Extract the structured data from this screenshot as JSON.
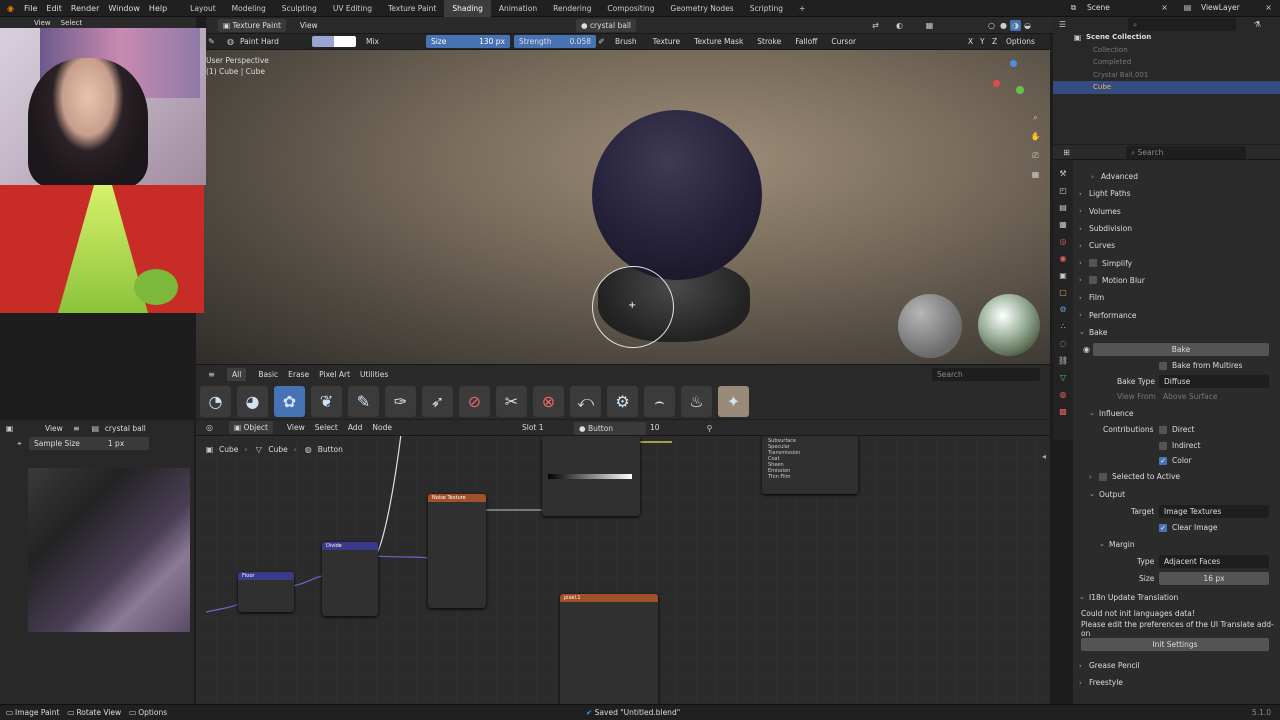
{
  "menu": [
    "File",
    "Edit",
    "Render",
    "Window",
    "Help"
  ],
  "workspaces": [
    "Layout",
    "Modeling",
    "Sculpting",
    "UV Editing",
    "Texture Paint",
    "Shading",
    "Animation",
    "Rendering",
    "Compositing",
    "Geometry Nodes",
    "Scripting"
  ],
  "active_workspace": "Shading",
  "scene": "Scene",
  "view_layer": "ViewLayer",
  "sub_left": {
    "view": "View",
    "select": "Select"
  },
  "viewport_header": {
    "mode": "Texture Paint",
    "view": "View",
    "object_name": "crystal ball",
    "brush": "Paint Hard",
    "blend": "Mix",
    "size_label": "Size",
    "size_value": "130 px",
    "strength_label": "Strength",
    "strength_value": "0.058",
    "menus": [
      "Brush",
      "Texture",
      "Texture Mask",
      "Stroke",
      "Falloff",
      "Cursor"
    ],
    "axes": [
      "X",
      "Y",
      "Z"
    ],
    "options": "Options"
  },
  "viewport": {
    "perspective": "User Perspective",
    "object": "(1) Cube | Cube"
  },
  "brush_tabs": [
    "All",
    "Basic",
    "Erase",
    "Pixel Art",
    "Utilities"
  ],
  "brush_search_placeholder": "Search",
  "outliner": {
    "title": "Scene Collection",
    "items": [
      "Collection",
      "Completed",
      "Crystal Ball.001",
      "Cube"
    ]
  },
  "props_search_placeholder": "Search",
  "properties": {
    "sections": [
      "Advanced",
      "Light Paths",
      "Volumes",
      "Subdivision",
      "Curves",
      "Simplify",
      "Motion Blur",
      "Film",
      "Performance",
      "Bake"
    ],
    "bake_button": "Bake",
    "bake_from_multires": "Bake from Multires",
    "bake_type_label": "Bake Type",
    "bake_type_value": "Diffuse",
    "view_from_label": "View From",
    "view_from_value": "Above Surface",
    "influence": "Influence",
    "contributions": "Contributions",
    "direct": "Direct",
    "indirect": "Indirect",
    "color": "Color",
    "selected_to_active": "Selected to Active",
    "output": "Output",
    "target_label": "Target",
    "target_value": "Image Textures",
    "clear_image": "Clear Image",
    "margin": "Margin",
    "type_label": "Type",
    "type_value": "Adjacent Faces",
    "size_label": "Size",
    "size_value": "16 px",
    "i18n_title": "I18n Update Translation",
    "i18n_msg1": "Could not init languages data!",
    "i18n_msg2": "Please edit the preferences of the UI Translate add-on",
    "init_settings": "Init Settings",
    "grease_pencil": "Grease Pencil",
    "freestyle": "Freestyle"
  },
  "image_editor": {
    "view": "View",
    "image_name": "crystal ball",
    "sample_size_label": "Sample Size",
    "sample_size_value": "1 px"
  },
  "node_editor": {
    "object_mode": "Object",
    "menus": [
      "View",
      "Select",
      "Add",
      "Node"
    ],
    "slot": "Slot 1",
    "material": "Button",
    "users": "10",
    "breadcrumb": [
      "Cube",
      "Cube",
      "Button"
    ]
  },
  "nodes": {
    "noise": "Noise Texture",
    "divide": "Divide",
    "floor": "Floor",
    "image": "pixel.1",
    "bsdf": [
      "Subsurface",
      "Specular",
      "Transmission",
      "Coat",
      "Sheen",
      "Emission",
      "Thin Film"
    ]
  },
  "status": {
    "left": [
      "Image Paint",
      "Rotate View",
      "Options"
    ],
    "message": "Saved \"Untitled.blend\"",
    "version": "5.1.0"
  }
}
